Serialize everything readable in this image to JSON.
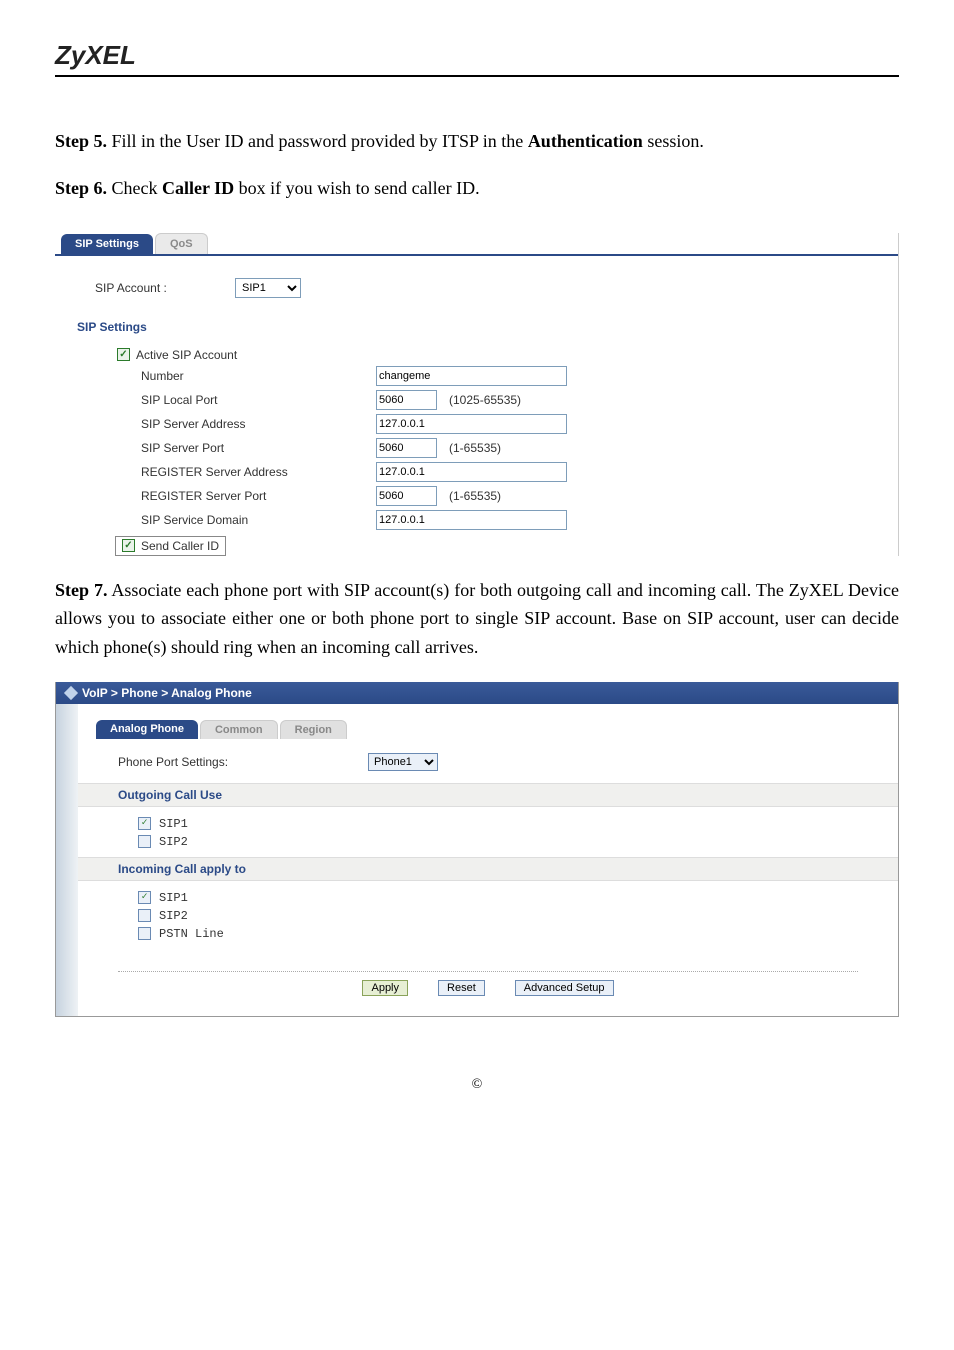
{
  "header": {
    "logo": "ZyXEL"
  },
  "steps": {
    "s5_prefix": "Step 5.",
    "s5_rest_a": " Fill in the User ID and password provided by ITSP in the ",
    "s5_bold": "Authentication",
    "s5_rest_b": " session.",
    "s6_prefix": "Step 6.",
    "s6_rest_a": " Check ",
    "s6_bold": "Caller ID",
    "s6_rest_b": " box if you wish to send caller ID.",
    "s7_prefix": "Step 7.",
    "s7_rest": "  Associate each phone port with SIP account(s) for both outgoing call and incoming call. The ZyXEL Device allows you to associate either one or both phone port to single SIP account.  Base on SIP account, user can decide which phone(s) should ring when an incoming call arrives."
  },
  "shot1": {
    "tabs": {
      "sip": "SIP Settings",
      "qos": "QoS"
    },
    "sip_account_label": "SIP Account :",
    "sip_account_value": "SIP1",
    "section_title": "SIP Settings",
    "active_sip": "Active SIP Account",
    "fields": {
      "number_label": "Number",
      "number_value": "changeme",
      "local_port_label": "SIP Local Port",
      "local_port_value": "5060",
      "local_port_hint": "(1025-65535)",
      "server_addr_label": "SIP Server Address",
      "server_addr_value": "127.0.0.1",
      "server_port_label": "SIP Server Port",
      "server_port_value": "5060",
      "server_port_hint": "(1-65535)",
      "reg_addr_label": "REGISTER Server Address",
      "reg_addr_value": "127.0.0.1",
      "reg_port_label": "REGISTER Server Port",
      "reg_port_value": "5060",
      "reg_port_hint": "(1-65535)",
      "service_domain_label": "SIP Service Domain",
      "service_domain_value": "127.0.0.1"
    },
    "send_caller_id": "Send Caller ID"
  },
  "shot2": {
    "breadcrumb": "VoIP > Phone > Analog Phone",
    "tabs": {
      "analog": "Analog Phone",
      "common": "Common",
      "region": "Region"
    },
    "port_label": "Phone Port Settings:",
    "port_value": "Phone1",
    "outgoing_header": "Outgoing Call Use",
    "incoming_header": "Incoming Call apply to",
    "items": {
      "sip1": "SIP1",
      "sip2": "SIP2",
      "pstn": "PSTN Line"
    },
    "buttons": {
      "apply": "Apply",
      "reset": "Reset",
      "adv": "Advanced Setup"
    }
  },
  "footer": {
    "copyright": "©"
  }
}
